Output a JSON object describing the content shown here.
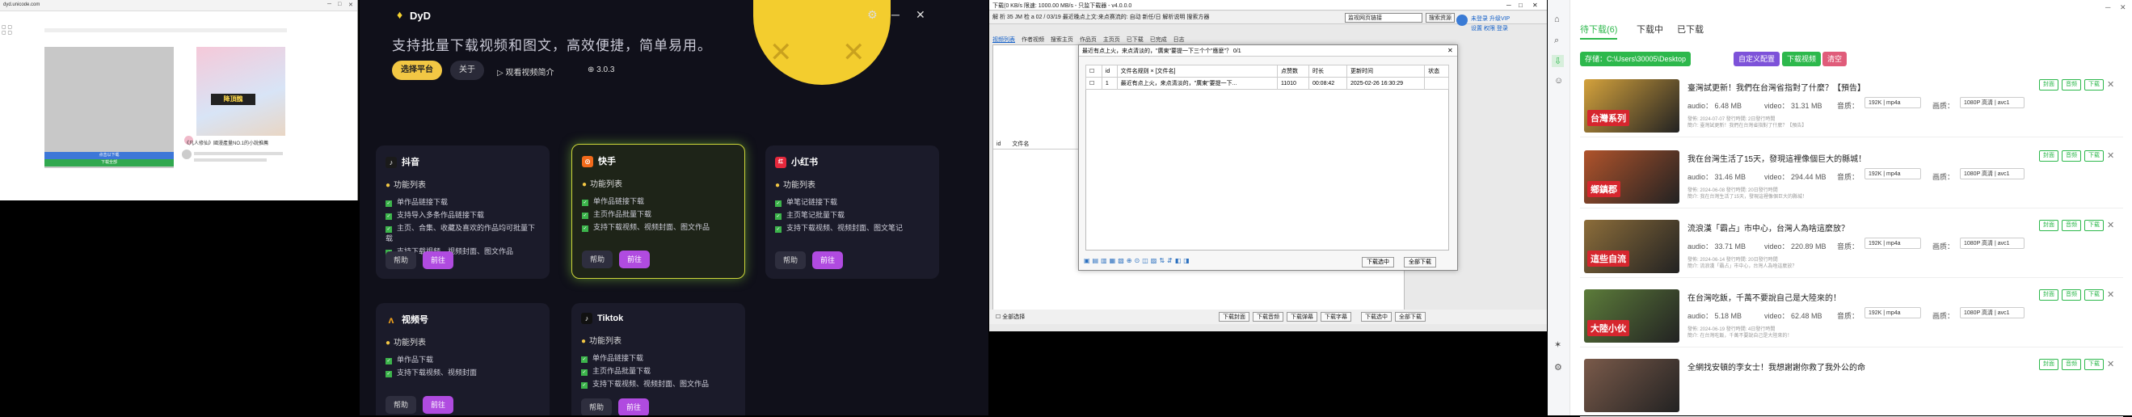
{
  "panel1": {
    "window_title": "dyd.unicode.com",
    "thumb_banner": "降頂醜",
    "caption": "《凡人修仙》國漫產量NO.1的小說推薦",
    "bar1_text": "点击以下载",
    "bar2_text": "下载全部"
  },
  "dyd": {
    "app_name": "DyD",
    "slogan": "支持批量下载视频和图文，高效便捷，简单易用。",
    "select_platform": "选择平台",
    "about": "关于",
    "watch_intro": "观看视频简介",
    "version": "3.0.3",
    "cards": [
      {
        "name": "抖音",
        "icon_color": "#1a1a1a",
        "feature_title": "功能列表",
        "items": [
          "单作品链接下载",
          "支持导入多条作品链接下载",
          "主页、合集、收藏及喜欢的作品均可批量下载",
          "支持下载视频、视频封面、图文作品"
        ],
        "help": "帮助",
        "go": "前往"
      },
      {
        "name": "快手",
        "icon_color": "#f26a1b",
        "feature_title": "功能列表",
        "items": [
          "单作品链接下载",
          "主页作品批量下载",
          "支持下载视频、视频封面、图文作品"
        ],
        "help": "帮助",
        "go": "前往"
      },
      {
        "name": "小红书",
        "icon_color": "#e6283c",
        "feature_title": "功能列表",
        "items": [
          "单笔记链接下载",
          "主页笔记批量下载",
          "支持下载视频、视频封面、图文笔记"
        ],
        "help": "帮助",
        "go": "前往"
      },
      {
        "name": "视频号",
        "icon_color": "#f2a21b",
        "feature_title": "功能列表",
        "items": [
          "单作品下载",
          "支持下载视频、视频封面"
        ],
        "help": "帮助",
        "go": "前往"
      },
      {
        "name": "Tiktok",
        "icon_color": "#111111",
        "feature_title": "功能列表",
        "items": [
          "单作品链接下载",
          "主页作品批量下载",
          "支持下载视频、视频封面、图文作品"
        ],
        "help": "帮助",
        "go": "前往"
      }
    ]
  },
  "p3": {
    "title": "下载(0 KB/s 限速: 1000.00 MB/s - 只监下载器 - v4.0.0.0",
    "row2": "解 析 35 JM 检 a 02 / 03/19 最近晚点上文:来点赛流的: 自动 新任/日 解析说明 搜索方器",
    "search_box": "监视网页链接",
    "search_btn": "搜索资源",
    "login": "未登录 升级VIP",
    "login2": "设置 权限 登录",
    "tabs": [
      "视频列表",
      "作者视频",
      "搜索主页",
      "作品页",
      "主页页",
      "已下载",
      "已完成",
      "日志"
    ],
    "list_headers": [
      "id",
      "文件名"
    ],
    "bottom_left": "全部选择",
    "bottom_btns": [
      "下载封面",
      "下载音频",
      "下载弹幕",
      "下载字幕",
      "下载选中",
      "全部下载"
    ],
    "dialog": {
      "title": "最近有点上火，来点清淡的，\"廣東\"要提一下三个个\"應麼\"？ 0/1",
      "headers": [
        "",
        "id",
        "文件名规则 × [文件名]",
        "点赞数",
        "时长",
        "更新时间",
        "状态"
      ],
      "rows": [
        [
          "",
          "1",
          "最近有点上火，来点清淡的，\"廣東\"要提一下...",
          "11010",
          "00:08:42",
          "2025-02-26 16:30:29",
          ""
        ]
      ],
      "buttons": [
        "下载选中",
        "全部下载"
      ]
    }
  },
  "p4": {
    "tabs": [
      "待下载(6)",
      "下载中",
      "已下载"
    ],
    "path_label": "存储：C:\\Users\\30005\\Desktop",
    "btns": [
      "自定义配置",
      "下载视频",
      "清空"
    ],
    "items": [
      {
        "title": "臺灣試更新！我們在台灣省指對了什麼？【預告】",
        "audio": "audio： 6.48 MB",
        "video": "video： 31.31 MB",
        "date": "發佈: 2024-07-07 發行時間: 2日發行時間",
        "desc": "簡介: 臺灣試更新！我們在台灣省指對了什麼？【預告】",
        "thumb_label": "台灣系列",
        "thumb_bg": "#d4a23c",
        "audio_q": "192K | mp4a",
        "video_q": "1080P 高清 | avc1"
      },
      {
        "title": "我在台灣生活了15天，發現這裡像個巨大的縣城！",
        "audio": "audio： 31.46 MB",
        "video": "video： 294.44 MB",
        "date": "發佈: 2024-06-08 發行時間: 20日發行時間",
        "desc": "簡介: 我在台灣生活了15天，發現這裡像個巨大的縣城！",
        "thumb_label": "鄉鎮郡",
        "thumb_bg": "#b0532b",
        "audio_q": "192K | mp4a",
        "video_q": "1080P 高清 | avc1"
      },
      {
        "title": "流浪漢「霸占」市中心，台灣人為啥這麼放？",
        "audio": "audio： 33.71 MB",
        "video": "video： 220.89 MB",
        "date": "發佈: 2024-06-14 發行時間: 20日發行時間",
        "desc": "簡介: 流浪漢「霸占」市中心，台灣人為啥這麼放？",
        "thumb_label": "這些自流",
        "thumb_bg": "#8c6d3a",
        "audio_q": "192K | mp4a",
        "video_q": "1080P 高清 | avc1"
      },
      {
        "title": "在台灣吃飯，千萬不要說自己是大陸來的！",
        "audio": "audio： 5.18 MB",
        "video": "video： 62.48 MB",
        "date": "發佈: 2024-06-19 發行時間: 4日發行時間",
        "desc": "簡介: 在台灣吃飯，千萬不要說自己是大陸來的！",
        "thumb_label": "大陸小伙",
        "thumb_bg": "#5c7c3a",
        "audio_q": "192K | mp4a",
        "video_q": "1080P 高清 | avc1"
      },
      {
        "title": "全網找安頓的李女士！我想謝謝你救了我外公的命",
        "audio": "",
        "video": "",
        "date": "",
        "desc": "",
        "thumb_label": "",
        "thumb_bg": "#7a5a4a",
        "audio_q": "",
        "video_q": ""
      }
    ],
    "row_btns": [
      "封面",
      "音频",
      "下载"
    ],
    "audio_label": "音质：",
    "video_label": "画质："
  }
}
